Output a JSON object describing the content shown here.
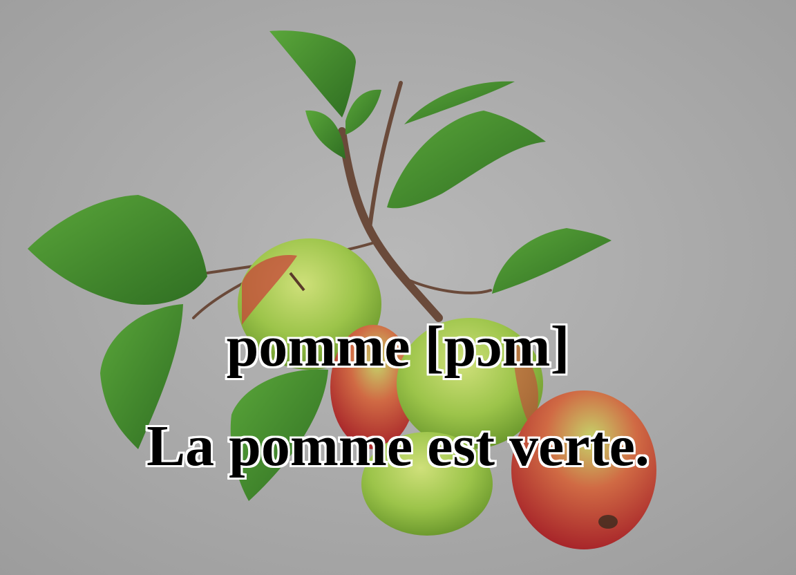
{
  "image": {
    "subject": "green and red apples on a branch with leaves",
    "background_color": "#a9a9a9"
  },
  "caption": {
    "word": "pomme [pɔm]",
    "sentence": "La pomme est verte."
  },
  "colors": {
    "text": "#000000",
    "text_outline": "#ffffff",
    "leaf": "#3f8a2c",
    "apple_green": "#9cc44a",
    "apple_red": "#c23a2e",
    "branch": "#6a4a3a"
  }
}
